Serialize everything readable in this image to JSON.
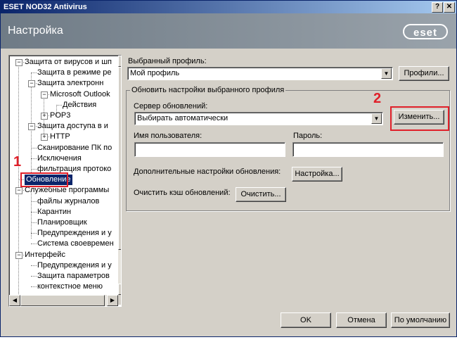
{
  "window": {
    "title": "ESET NOD32 Antivirus",
    "help_btn": "?",
    "close_btn": "✕"
  },
  "header": {
    "title": "Настройка",
    "logo": "eset"
  },
  "tree": {
    "items": [
      {
        "label": "Защита от вирусов и шп",
        "level": 0,
        "box": "−"
      },
      {
        "label": "Защита в режиме ре",
        "level": 1,
        "box": ""
      },
      {
        "label": "Защита электронн",
        "level": 1,
        "box": "−"
      },
      {
        "label": "Microsoft Outlook",
        "level": 2,
        "box": "−"
      },
      {
        "label": "Действия",
        "level": 3,
        "box": ""
      },
      {
        "label": "POP3",
        "level": 2,
        "box": "+"
      },
      {
        "label": "Защита доступа в и",
        "level": 1,
        "box": "−"
      },
      {
        "label": "HTTP",
        "level": 2,
        "box": "+"
      },
      {
        "label": "Сканирование ПК по",
        "level": 1,
        "box": ""
      },
      {
        "label": "Исключения",
        "level": 1,
        "box": ""
      },
      {
        "label": "фильтрация протоко",
        "level": 1,
        "box": ""
      },
      {
        "label": "Обновление",
        "level": 0,
        "box": "",
        "selected": true
      },
      {
        "label": "Служебные программы",
        "level": 0,
        "box": "−"
      },
      {
        "label": "файлы журналов",
        "level": 1,
        "box": ""
      },
      {
        "label": "Карантин",
        "level": 1,
        "box": ""
      },
      {
        "label": "Планировщик",
        "level": 1,
        "box": ""
      },
      {
        "label": "Предупреждения и у",
        "level": 1,
        "box": ""
      },
      {
        "label": "Система своевремен",
        "level": 1,
        "box": ""
      },
      {
        "label": "Интерфейс",
        "level": 0,
        "box": "−"
      },
      {
        "label": "Предупреждения и у",
        "level": 1,
        "box": ""
      },
      {
        "label": "Защита параметров",
        "level": 1,
        "box": ""
      },
      {
        "label": "контекстное меню",
        "level": 1,
        "box": ""
      }
    ]
  },
  "annotations": {
    "marker1": "1",
    "marker2": "2"
  },
  "profile": {
    "label": "Выбранный профиль:",
    "value": "Мой профиль",
    "profiles_btn": "Профили..."
  },
  "update_group": {
    "legend": "Обновить настройки выбранного профиля",
    "server_label": "Сервер обновлений:",
    "server_value": "Выбирать автоматически",
    "change_btn": "Изменить...",
    "username_label": "Имя пользователя:",
    "username_value": "",
    "password_label": "Пароль:",
    "password_value": "",
    "advanced_label": "Дополнительные настройки обновления:",
    "setup_btn": "Настройка...",
    "clear_cache_label": "Очистить кэш обновлений:",
    "clear_btn": "Очистить..."
  },
  "footer": {
    "ok_btn": "OK",
    "cancel_btn": "Отмена",
    "default_btn": "По умолчанию"
  }
}
